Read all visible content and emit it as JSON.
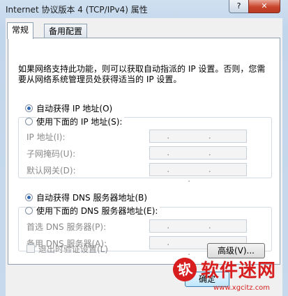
{
  "window": {
    "title": "Internet 协议版本 4 (TCP/IPv4) 属性",
    "help_label": "?",
    "close_label": "✕"
  },
  "tabs": [
    {
      "label": "常规",
      "active": true
    },
    {
      "label": "备用配置",
      "active": false
    }
  ],
  "description": "如果网络支持此功能，则可以获取自动指派的 IP 设置。否则，您需要从网络系统管理员处获得适当的 IP 设置。",
  "ip_section": {
    "auto_label": "自动获得 IP 地址(O)",
    "auto_selected": true,
    "manual_label": "使用下面的 IP 地址(S):",
    "fields": [
      {
        "label": "IP 地址(I):",
        "value": ". . ."
      },
      {
        "label": "子网掩码(U):",
        "value": ". . ."
      },
      {
        "label": "默认网关(D):",
        "value": ". . ."
      }
    ]
  },
  "dns_section": {
    "auto_label": "自动获得 DNS 服务器地址(B)",
    "auto_selected": true,
    "manual_label": "使用下面的 DNS 服务器地址(E):",
    "fields": [
      {
        "label": "首选 DNS 服务器(P):",
        "value": ". . ."
      },
      {
        "label": "备用 DNS 服务器(A):",
        "value": ". . ."
      }
    ]
  },
  "validate_label": "退出时验证设置(L)",
  "validate_checked": false,
  "advanced_button": "高级(V)...",
  "ok_button": "确定",
  "watermark": {
    "badge": "软",
    "name": "软件迷网",
    "url": "www.xgcitz.com"
  },
  "colors": {
    "title_bar": "#c2d6eb",
    "radio_dot": "#2f6ab1",
    "watermark": "#d71d1d"
  }
}
